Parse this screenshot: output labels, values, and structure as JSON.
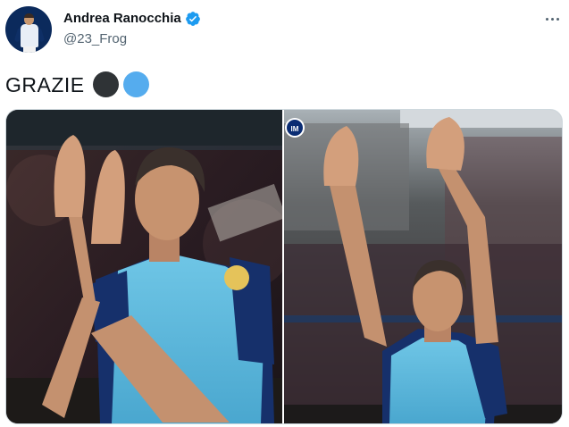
{
  "author": {
    "display_name": "Andrea Ranocchia",
    "handle": "@23_Frog",
    "verified": true
  },
  "tweet": {
    "text": "GRAZIE",
    "emoji": [
      {
        "name": "black-circle",
        "color": "#2f3336"
      },
      {
        "name": "blue-circle",
        "color": "#55acee"
      }
    ]
  },
  "media": {
    "photos": [
      {
        "name": "player-applauding-photo"
      },
      {
        "name": "player-waving-photo",
        "logo": "inter-logo"
      }
    ]
  },
  "colors": {
    "verified": "#1d9bf0",
    "jersey_bib": "#5ab8dc",
    "jersey_dark": "#16306b"
  },
  "icons": [
    "verified-badge-icon",
    "more-options-icon",
    "inter-logo"
  ]
}
